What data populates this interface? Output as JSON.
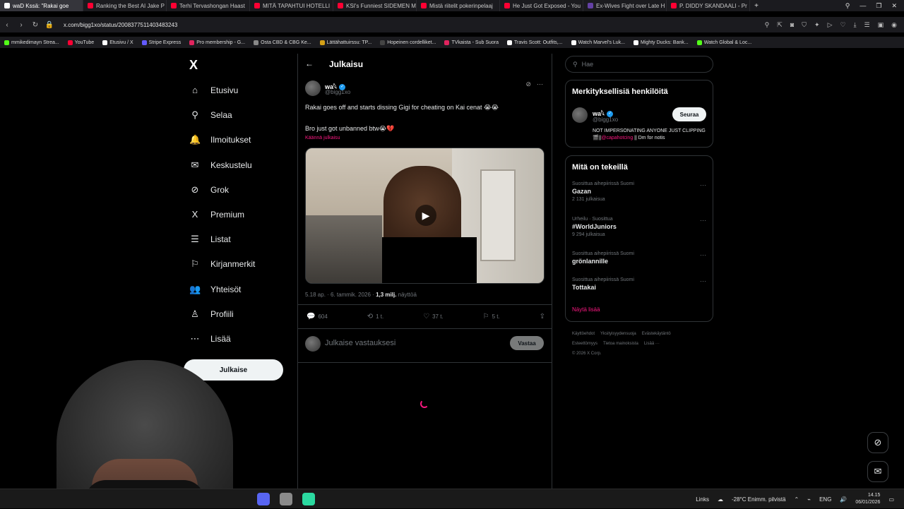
{
  "browser": {
    "tabs": [
      {
        "label": "waD Kssä: \"Rakai goe",
        "color": "#ffffff",
        "active": true
      },
      {
        "label": "Ranking the Best AI Jake P",
        "color": "#ff0033"
      },
      {
        "label": "Terhi Tervashongan Haast",
        "color": "#ff0033"
      },
      {
        "label": "MITÄ TAPAHTUI HOTELLI",
        "color": "#ff0033"
      },
      {
        "label": "KSI's Funniest SIDEMEN M",
        "color": "#ff0033"
      },
      {
        "label": "Mistä riitelit pokerinpelaaj",
        "color": "#ff0033"
      },
      {
        "label": "He Just Got Exposed - You",
        "color": "#ff0033"
      },
      {
        "label": "Ex-Wives Fight over Late H",
        "color": "#6441a5"
      },
      {
        "label": "P. DIDDY SKANDAALI - Pr",
        "color": "#ff0033"
      }
    ],
    "new_tab": "+",
    "url": "x.com/bigg1xo/status/2008377511403483243",
    "bookmarks": [
      {
        "label": "mmikedimayn Strea...",
        "color": "#53fc18"
      },
      {
        "label": "YouTube",
        "color": "#ff0033"
      },
      {
        "label": "Etusivu / X",
        "color": "#ffffff"
      },
      {
        "label": "Stripe Express",
        "color": "#635bff"
      },
      {
        "label": "Pro membership - G...",
        "color": "#e0245e"
      },
      {
        "label": "Osta CBD & CBG Ke...",
        "color": "#888888"
      },
      {
        "label": "Lättähattuirssu: TP...",
        "color": "#d4a017"
      },
      {
        "label": "Hopeinen cordelliket...",
        "color": "#444444"
      },
      {
        "label": "TVkaista - Sub Suora",
        "color": "#e0245e"
      },
      {
        "label": "Travis Scott: Outfits,...",
        "color": "#ffffff"
      },
      {
        "label": "Watch Marvel's Luk...",
        "color": "#ffffff"
      },
      {
        "label": "Mighty Ducks: Bank...",
        "color": "#ffffff"
      },
      {
        "label": "Watch Global & Loc...",
        "color": "#53fc18"
      }
    ]
  },
  "sidebar": {
    "logo": "X",
    "items": [
      {
        "label": "Etusivu",
        "icon": "home-icon",
        "glyph": "⌂"
      },
      {
        "label": "Selaa",
        "icon": "search-icon",
        "glyph": "⚲"
      },
      {
        "label": "Ilmoitukset",
        "icon": "bell-icon",
        "glyph": "🔔"
      },
      {
        "label": "Keskustelu",
        "icon": "mail-icon",
        "glyph": "✉"
      },
      {
        "label": "Grok",
        "icon": "grok-icon",
        "glyph": "⊘"
      },
      {
        "label": "Premium",
        "icon": "x-premium-icon",
        "glyph": "X"
      },
      {
        "label": "Listat",
        "icon": "list-icon",
        "glyph": "☰"
      },
      {
        "label": "Kirjanmerkit",
        "icon": "bookmark-icon",
        "glyph": "⚐"
      },
      {
        "label": "Yhteisöt",
        "icon": "communities-icon",
        "glyph": "👥"
      },
      {
        "label": "Profiili",
        "icon": "profile-icon",
        "glyph": "♙"
      },
      {
        "label": "Lisää",
        "icon": "more-circle-icon",
        "glyph": "⋯"
      }
    ],
    "post_button": "Julkaise"
  },
  "post": {
    "header_title": "Julkaisu",
    "author_name": "wa𓆩",
    "author_handle": "@bigg1xo",
    "text_line1": "Rakai goes off and starts dissing Gigi for cheating on Kai cenat 😭😭",
    "text_line2": "Bro just got unbanned btw😭💔",
    "translate": "Käännä julkaisu",
    "time": "5.18 ap. · 6. tammik. 2026 ·",
    "views_count": "1,3 milj.",
    "views_label": "näyttöä",
    "actions": {
      "replies": "604",
      "reposts": "1 t.",
      "likes": "37 t.",
      "bookmarks": "5 t."
    },
    "reply_placeholder": "Julkaise vastauksesi",
    "reply_button": "Vastaa"
  },
  "right_sidebar": {
    "search_placeholder": "Hae",
    "relevant_title": "Merkityksellisiä henkilöitä",
    "relevant_person": {
      "name": "wa𓆩",
      "handle": "@bigg1xo",
      "follow": "Seuraa",
      "bio_line1": "NOT IMPERSONATING ANYONE JUST CLIPPING",
      "bio_prefix": "🎬||",
      "bio_mention": "@capahotcing",
      "bio_suffix": " || Dm for notis"
    },
    "trends_title": "Mitä on tekeillä",
    "trends": [
      {
        "category": "Suosittua aihepiirissä Suomi",
        "name": "Gazan",
        "count": "2 131 julkaisua"
      },
      {
        "category": "Urheilu · Suosittua",
        "name": "#WorldJuniors",
        "count": "9 294 julkaisua"
      },
      {
        "category": "Suosittua aihepiirissä Suomi",
        "name": "grönlannille",
        "count": ""
      },
      {
        "category": "Suosittua aihepiirissä Suomi",
        "name": "Tottakai",
        "count": ""
      }
    ],
    "show_more": "Näytä lisää",
    "footer": [
      "Käyttöehdot",
      "Yksityisyydensuoja",
      "Evästekäytäntö",
      "Esteettömyys",
      "Tietoa mainoksista",
      "Lisää ···",
      "© 2026 X Corp."
    ]
  },
  "taskbar": {
    "links": "Links",
    "weather": "-28°C  Enimm. pilvistä",
    "lang": "ENG",
    "time": "14.15",
    "date": "06/01/2026"
  }
}
